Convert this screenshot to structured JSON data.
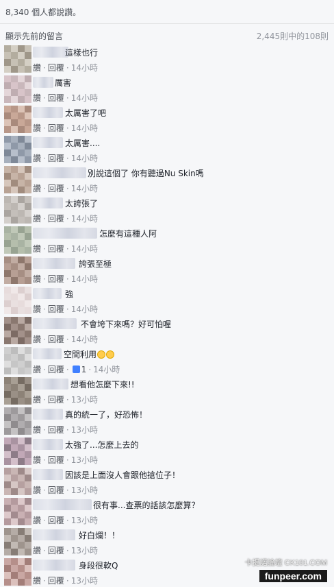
{
  "likes_text": "8,340 個人都說讚。",
  "previous_link": "顯示先前的留言",
  "comment_counter": "2,445則中的108則",
  "actions": {
    "like": "讚",
    "reply": "回覆"
  },
  "comments": [
    {
      "text": "這樣也行",
      "time": "14小時"
    },
    {
      "text": "厲害",
      "time": "14小時"
    },
    {
      "text": "太厲害了吧",
      "time": "14小時"
    },
    {
      "text": "太厲害....",
      "time": "14小時"
    },
    {
      "text": "別說這個了 你有聽過Nu Skin嗎",
      "time": "14小時"
    },
    {
      "text": "太誇張了",
      "time": "14小時"
    },
    {
      "text": "怎麼有這種人阿",
      "time": "14小時"
    },
    {
      "text": "誇張至極",
      "time": "14小時"
    },
    {
      "text": "強",
      "time": "14小時"
    },
    {
      "text": "不會垮下來嗎？好可怕喔",
      "time": "14小時"
    },
    {
      "text": "空間利用",
      "time": "14小時",
      "reactions": "1"
    },
    {
      "text": "想看他怎麼下來!!",
      "time": "13小時"
    },
    {
      "text": "真的統一了，好恐怖！",
      "time": "13小時"
    },
    {
      "text": "太強了...怎麼上去的",
      "time": "13小時"
    },
    {
      "text": "因該是上面沒人會跟他搶位子！",
      "time": "13小時"
    },
    {
      "text": "很有事...查票的話該怎麼算？",
      "time": "13小時"
    },
    {
      "text": "好白爛！！",
      "time": "13小時"
    },
    {
      "text": "身段很軟Q",
      "time": "13小時"
    }
  ],
  "watermark": {
    "site": "funpeer.com",
    "tag": "卡提諾論壇 CK101.COM"
  }
}
